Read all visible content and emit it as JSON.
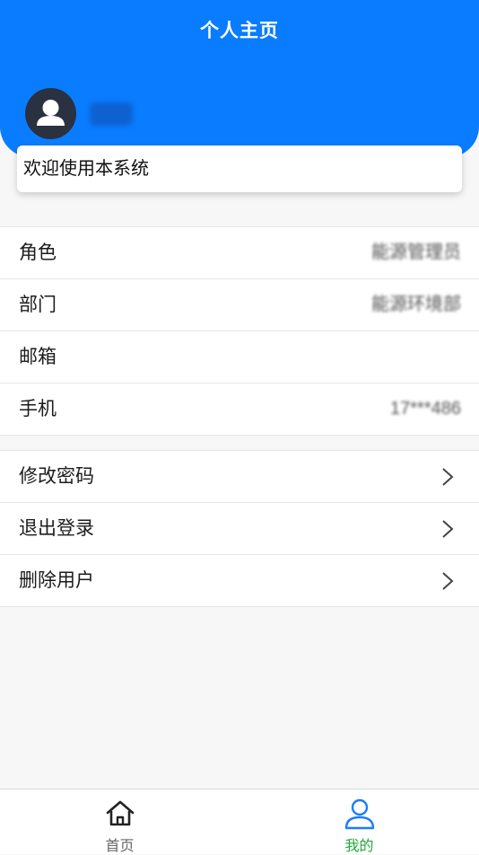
{
  "header": {
    "title": "个人主页",
    "username": "",
    "icons": {
      "avatar": "user-avatar-icon"
    }
  },
  "welcome": {
    "text": "欢迎使用本系统"
  },
  "info": {
    "rows": [
      {
        "label": "角色",
        "value": "能源管理员"
      },
      {
        "label": "部门",
        "value": "能源环境部"
      },
      {
        "label": "邮箱",
        "value": ""
      },
      {
        "label": "手机",
        "value": "17***486"
      }
    ]
  },
  "actions": {
    "rows": [
      {
        "label": "修改密码",
        "icon": "chevron-right-icon"
      },
      {
        "label": "退出登录",
        "icon": "chevron-right-icon"
      },
      {
        "label": "删除用户",
        "icon": "chevron-right-icon"
      }
    ]
  },
  "tabbar": {
    "tabs": [
      {
        "label": "首页",
        "icon": "home-icon",
        "active": false
      },
      {
        "label": "我的",
        "icon": "user-icon",
        "active": true
      }
    ]
  },
  "colors": {
    "primary": "#0a7cff",
    "active_tab": "#22a93a",
    "avatar_bg": "#2a3140",
    "background": "#f7f7f7"
  }
}
